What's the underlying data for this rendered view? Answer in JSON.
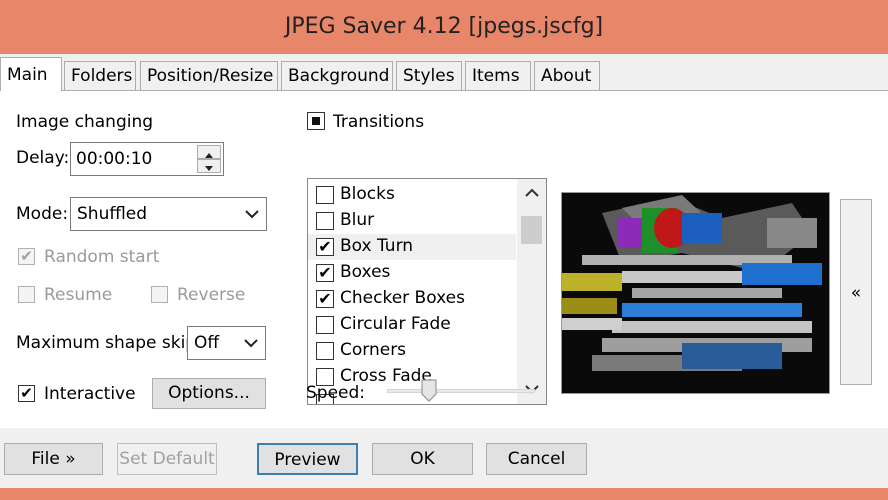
{
  "window": {
    "title": "JPEG Saver 4.12 [jpegs.jscfg]"
  },
  "tabs": [
    {
      "label": "Main",
      "active": true
    },
    {
      "label": "Folders"
    },
    {
      "label": "Position/Resize"
    },
    {
      "label": "Background"
    },
    {
      "label": "Styles"
    },
    {
      "label": "Items"
    },
    {
      "label": "About"
    }
  ],
  "main": {
    "image_changing_label": "Image changing",
    "delay_label": "Delay:",
    "delay_value": "00:00:10",
    "mode_label": "Mode:",
    "mode_value": "Shuffled",
    "random_start_label": "Random start",
    "random_start_checked": true,
    "resume_label": "Resume",
    "reverse_label": "Reverse",
    "max_shape_skip_label": "Maximum shape skip:",
    "max_shape_skip_value": "Off",
    "interactive_label": "Interactive",
    "interactive_checked": true,
    "options_label": "Options...",
    "transitions_label": "Transitions",
    "transitions": [
      {
        "label": "Blocks",
        "checked": false
      },
      {
        "label": "Blur",
        "checked": false
      },
      {
        "label": "Box Turn",
        "checked": true,
        "selected": true
      },
      {
        "label": "Boxes",
        "checked": true
      },
      {
        "label": "Checker Boxes",
        "checked": true
      },
      {
        "label": "Circular Fade",
        "checked": false
      },
      {
        "label": "Corners",
        "checked": false
      },
      {
        "label": "Cross Fade",
        "checked": false
      }
    ],
    "speed_label": "Speed:",
    "speed_level": 0.26,
    "collapse_preview_glyph": "«"
  },
  "footer": {
    "file_label": "File »",
    "set_default_label": "Set Default",
    "preview_label": "Preview",
    "ok_label": "OK",
    "cancel_label": "Cancel"
  },
  "colors": {
    "title_bar": "#e8866a",
    "focus_border": "#3c7fb1"
  },
  "icons": {
    "spin_up": "chevron-up-icon",
    "spin_down": "chevron-down-icon",
    "dropdown": "chevron-down-icon",
    "checkmark": "checkmark-icon"
  }
}
